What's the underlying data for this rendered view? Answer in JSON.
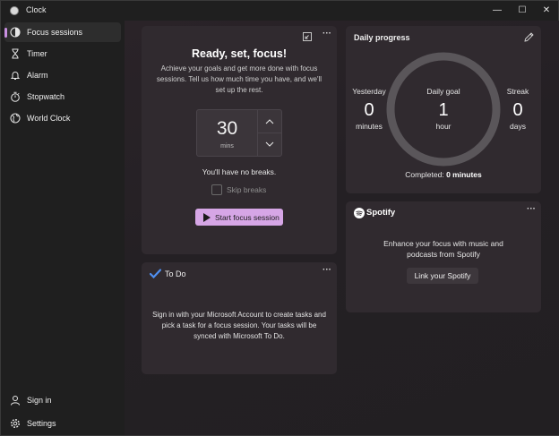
{
  "app": {
    "title": "Clock"
  },
  "window_controls": {
    "minimize": "—",
    "maximize": "☐",
    "close": "✕"
  },
  "sidebar": {
    "items": [
      {
        "label": "Focus sessions",
        "icon": "focus-icon",
        "active": true
      },
      {
        "label": "Timer",
        "icon": "hourglass-icon"
      },
      {
        "label": "Alarm",
        "icon": "bell-icon"
      },
      {
        "label": "Stopwatch",
        "icon": "stopwatch-icon"
      },
      {
        "label": "World Clock",
        "icon": "globe-icon"
      }
    ],
    "bottom": [
      {
        "label": "Sign in",
        "icon": "person-icon"
      },
      {
        "label": "Settings",
        "icon": "gear-icon"
      }
    ]
  },
  "focus": {
    "title": "Ready, set, focus!",
    "description": "Achieve your goals and get more done with focus sessions. Tell us how much time you have, and we'll set up the rest.",
    "minutes_value": "30",
    "minutes_unit": "mins",
    "breaks_text": "You'll have no breaks.",
    "skip_breaks_label": "Skip breaks",
    "start_label": "Start focus session"
  },
  "todo": {
    "title": "To Do",
    "message": "Sign in with your Microsoft Account to create tasks and pick a task for a focus session. Your tasks will be synced with Microsoft To Do."
  },
  "progress": {
    "title": "Daily progress",
    "yesterday": {
      "label": "Yesterday",
      "value": "0",
      "unit": "minutes"
    },
    "daily_goal": {
      "label": "Daily goal",
      "value": "1",
      "unit": "hour"
    },
    "streak": {
      "label": "Streak",
      "value": "0",
      "unit": "days"
    },
    "completed_label": "Completed:",
    "completed_value": "0 minutes",
    "completion_fraction": 0
  },
  "spotify": {
    "brand": "Spotify",
    "message": "Enhance your focus with music and podcasts from Spotify",
    "link_label": "Link your Spotify"
  },
  "colors": {
    "accent": "#d6a6e6",
    "card": "#302a2f",
    "sidebar_bg": "#1f1f1f"
  }
}
